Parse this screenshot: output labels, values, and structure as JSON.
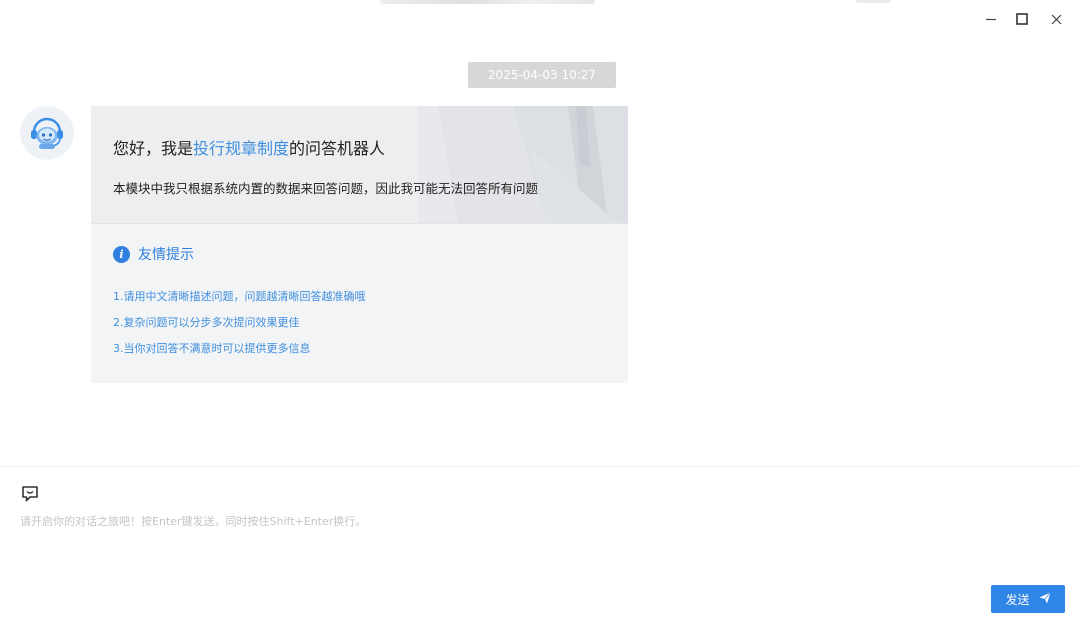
{
  "window": {
    "controls": {
      "minimize_icon": "minimize-icon",
      "maximize_icon": "maximize-icon",
      "close_icon": "close-icon"
    }
  },
  "chat": {
    "timestamp": "2025-04-03 10:27",
    "bot_message": {
      "avatar_icon": "robot-headset-icon",
      "greeting_prefix": "您好，我是",
      "greeting_highlight": "投行规章制度",
      "greeting_suffix": "的问答机器人",
      "description": "本模块中我只根据系统内置的数据来回答问题，因此我可能无法回答所有问题",
      "tips_title": "友情提示",
      "tips": [
        "1.请用中文清晰描述问题，问题越清晰回答越准确哦",
        "2.复杂问题可以分步多次提问效果更佳",
        "3.当你对回答不满意时可以提供更多信息"
      ]
    }
  },
  "input": {
    "icon": "chat-bubble-icon",
    "placeholder": "请开启你的对话之旅吧！按Enter键发送，同时按住Shift+Enter换行。",
    "value": "",
    "send_label": "发送",
    "send_icon": "paper-plane-icon"
  },
  "colors": {
    "accent": "#2f86e6",
    "highlight_text": "#3f8fdf",
    "timestamp_bg": "#d7d7d7",
    "card_bg": "#f3f4f5"
  }
}
